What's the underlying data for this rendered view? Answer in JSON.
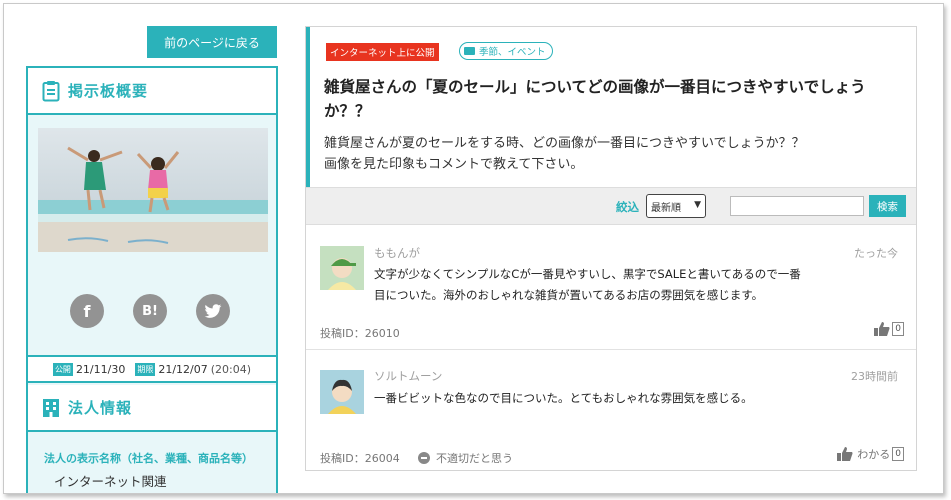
{
  "nav": {
    "back_label": "前のページに戻る"
  },
  "sidebar": {
    "summary_title": "掲示板概要",
    "social": {
      "facebook": "f",
      "hatena": "B!",
      "twitter": "twitter-bird"
    },
    "dates": {
      "public_tag": "公開",
      "public_date": "21/11/30",
      "deadline_tag": "期限",
      "deadline_date": "21/12/07",
      "deadline_time": "(20:04)"
    },
    "corp_title": "法人情報",
    "corp_field_label": "法人の表示名称（社名、業種、商品名等）",
    "corp_field_value": "インターネット関連"
  },
  "question": {
    "visibility_badge": "インターネット上に公開",
    "category_badge": "季節、イベント",
    "title": "雑貨屋さんの「夏のセール」についてどの画像が一番目につきやすいでしょうか？？",
    "desc_line1": "雑貨屋さんが夏のセールをする時、どの画像が一番目につきやすいでしょうか？？",
    "desc_line2": "画像を見た印象もコメントで教えて下さい。"
  },
  "filter": {
    "label": "絞込",
    "sort_value": "最新順",
    "search_placeholder": "",
    "search_button": "検索"
  },
  "comments": [
    {
      "name": "ももんが",
      "time": "たった今",
      "body_line1": "文字が少なくてシンプルなCが一番見やすいし、黒字でSALEと書いてあるので一番",
      "body_line2": "目についた。海外のおしゃれな雑貨が置いてあるお店の雰囲気を感じます。",
      "post_id": "投稿ID：26010",
      "like_count": "0"
    },
    {
      "name": "ソルトムーン",
      "time": "23時間前",
      "body_line1": "一番ビビットな色なので目についた。とてもおしゃれな雰囲気を感じる。",
      "post_id": "投稿ID：26004",
      "report_label": "不適切だと思う",
      "like_label": "わかる",
      "like_count": "0"
    }
  ],
  "colors": {
    "accent": "#2bb2ba",
    "badge_red": "#e8341f",
    "panel_bg": "#e8f7f9"
  }
}
